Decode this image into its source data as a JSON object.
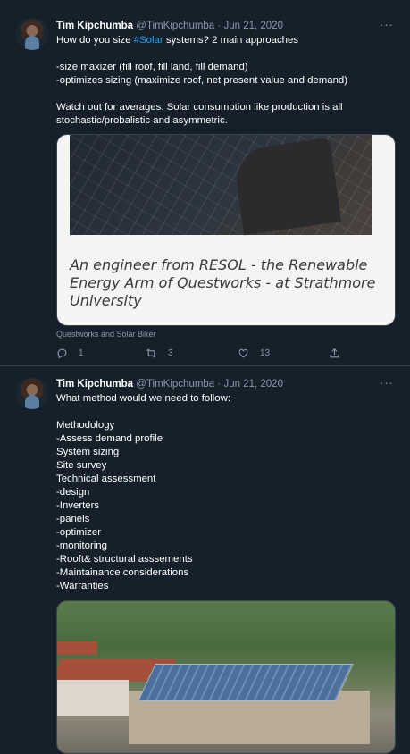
{
  "tweets": [
    {
      "author": "Tim Kipchumba",
      "handle": "@TimKipchumba",
      "sep": "·",
      "date": "Jun 21, 2020",
      "more": "···",
      "text_pre": "How do you size ",
      "hashtag": "#Solar",
      "text_post": " systems? 2 main approaches",
      "lines": [
        "-size maxizer (fill roof, fill land, fill demand)",
        "-optimizes sizing (maximize roof, net present value and demand)"
      ],
      "lines2": [
        "Watch out for averages. Solar consumption like production is all",
        "stochastic/probalistic and asymmetric."
      ],
      "card_caption": "An engineer from RESOL - the Renewable Energy Arm of Questworks - at Strathmore University",
      "attribution": "Questworks and Solar Biker",
      "replies": "1",
      "retweets": "3",
      "likes": "13"
    },
    {
      "author": "Tim Kipchumba",
      "handle": "@TimKipchumba",
      "sep": "·",
      "date": "Jun 21, 2020",
      "more": "···",
      "intro": "What method would we need to follow:",
      "lines": [
        "Methodology",
        "-Assess demand profile",
        "System sizing",
        "Site survey",
        "Technical assessment",
        "-design",
        "-Inverters",
        "-panels",
        "-optimizer",
        "-monitoring",
        "-Rooft& structural asssements",
        "-Maintainance considerations",
        "-Warranties"
      ]
    }
  ],
  "icons": [
    "reply-icon",
    "retweet-icon",
    "like-icon",
    "share-icon",
    "more-icon"
  ],
  "colors": {
    "background": "#15202b",
    "accent": "#1da1f2",
    "muted": "#8899a6",
    "border": "#38444d"
  }
}
